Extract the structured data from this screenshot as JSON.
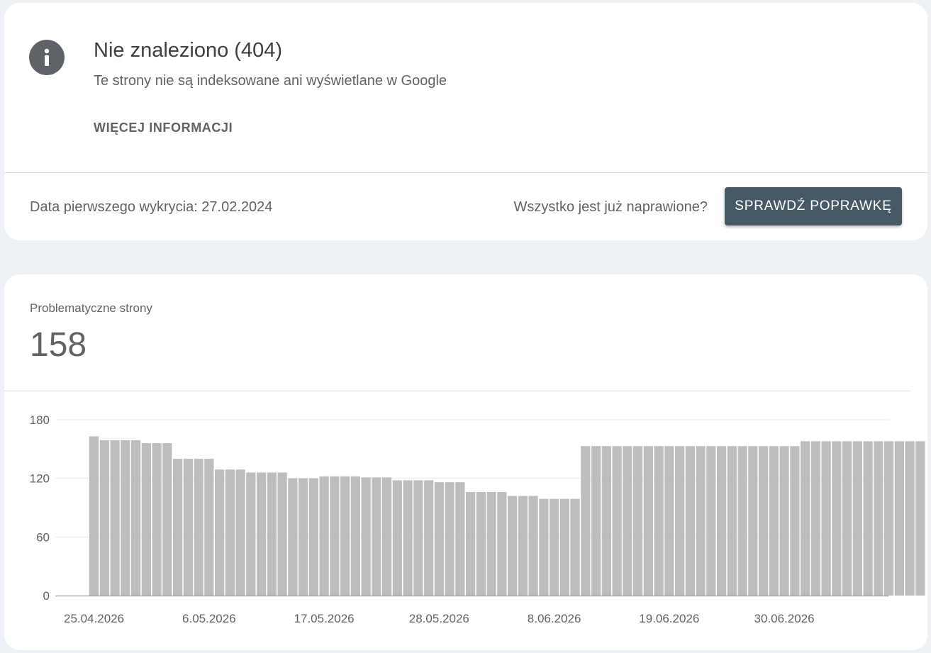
{
  "issue": {
    "title": "Nie znaleziono (404)",
    "subtitle": "Te strony nie są indeksowane ani wyświetlane w Google",
    "more_info_label": "WIĘCEJ INFORMACJI",
    "first_detected": "Data pierwszego wykrycia: 27.02.2024",
    "fixed_question": "Wszystko jest już naprawione?",
    "validate_label": "SPRAWDŹ POPRAWKĘ",
    "icon": "info-icon"
  },
  "metric": {
    "label": "Problematyczne strony",
    "value": "158"
  },
  "colors": {
    "bar": "#bdbdbd",
    "button": "#455a64",
    "icon": "#5f6368",
    "background": "#eef2f7"
  },
  "chart_data": {
    "type": "bar",
    "ylim": [
      0,
      180
    ],
    "yticks": [
      0,
      60,
      120,
      180
    ],
    "grid": true,
    "x_tick_labels": [
      "25.04.2026",
      "6.05.2026",
      "17.05.2026",
      "28.05.2026",
      "8.06.2026",
      "19.06.2026",
      "30.06.2026"
    ],
    "x_tick_every": 11,
    "values": [
      163,
      159,
      159,
      159,
      159,
      156,
      156,
      156,
      140,
      140,
      140,
      140,
      129,
      129,
      129,
      126,
      126,
      126,
      126,
      120,
      120,
      120,
      122,
      122,
      122,
      122,
      121,
      121,
      121,
      118,
      118,
      118,
      118,
      116,
      116,
      116,
      106,
      106,
      106,
      106,
      102,
      102,
      102,
      99,
      99,
      99,
      99,
      153,
      153,
      153,
      153,
      153,
      153,
      153,
      153,
      153,
      153,
      153,
      153,
      153,
      153,
      153,
      153,
      153,
      153,
      153,
      153,
      153,
      158,
      158,
      158,
      158,
      158,
      158,
      158,
      158,
      158,
      158,
      158,
      158
    ]
  }
}
